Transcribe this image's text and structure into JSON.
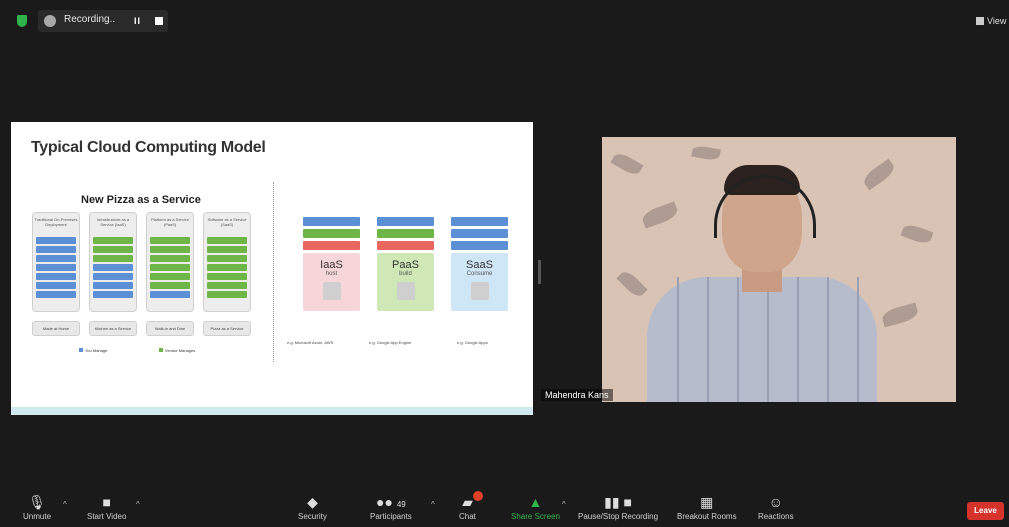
{
  "topbar": {
    "recording_label": "Recording..",
    "pause_label": "II",
    "view_label": "View"
  },
  "slide": {
    "title": "Typical Cloud Computing Model",
    "pizza_title": "New Pizza as a Service",
    "columns": [
      {
        "header": "Traditional On-Premises Deployment",
        "footer": "Made at Home"
      },
      {
        "header": "Infrastructure as a Service (IaaS)",
        "footer": "Kitchen as a Service"
      },
      {
        "header": "Platform as a Service (PaaS)",
        "footer": "Walk-in and Dine"
      },
      {
        "header": "Software as a Service (SaaS)",
        "footer": "Pizza as a Service"
      }
    ],
    "legend": {
      "you_manage": "You Manage",
      "vendor_manages": "Vendor Manages"
    },
    "services": [
      {
        "name": "IaaS",
        "sub": "host",
        "example": "e.g. Microsoft Azure, AWS"
      },
      {
        "name": "PaaS",
        "sub": "build",
        "example": "e.g. Google App Engine"
      },
      {
        "name": "SaaS",
        "sub": "Consume",
        "example": "e.g. Google Apps"
      }
    ]
  },
  "video": {
    "participant_name": "Mahendra Kans"
  },
  "toolbar": {
    "unmute": "Unmute",
    "start_video": "Start Video",
    "security": "Security",
    "participants": "Participants",
    "participants_count": "49",
    "chat": "Chat",
    "chat_badge": "",
    "share_screen": "Share Screen",
    "pause_stop_recording": "Pause/Stop Recording",
    "breakout_rooms": "Breakout Rooms",
    "reactions": "Reactions",
    "leave": "Leave"
  },
  "colors": {
    "share_green": "#2fb34a",
    "leave_red": "#d5332c",
    "badge_red": "#e0402a"
  },
  "icons": [
    "shield-icon",
    "cloud-icon",
    "pause-icon",
    "stop-icon",
    "microphone-muted-icon",
    "video-off-icon",
    "security-icon",
    "participants-icon",
    "chat-icon",
    "share-screen-icon",
    "recording-icon",
    "breakout-icon",
    "reactions-icon"
  ]
}
